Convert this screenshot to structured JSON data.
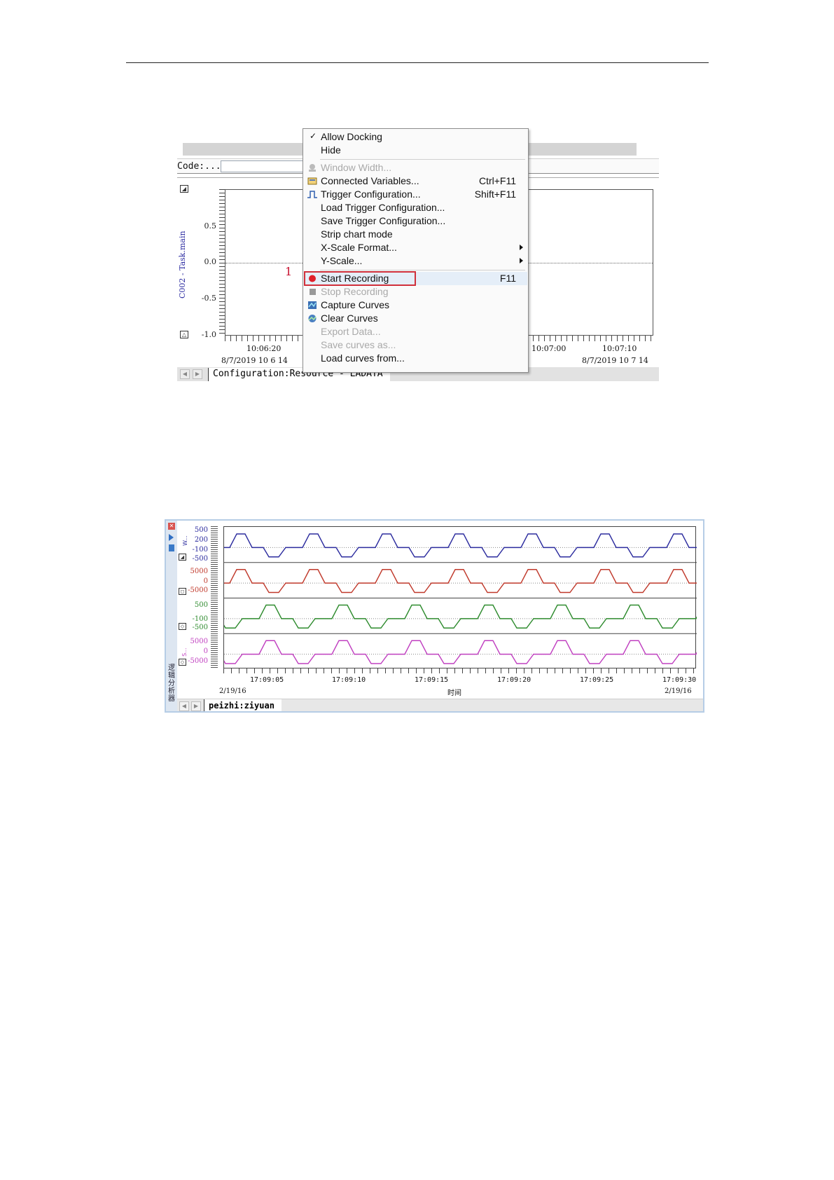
{
  "screenshot1": {
    "code_label": "Code:...",
    "y_axis_label": "C002 - Task.main",
    "y_ticks": [
      "0.5",
      "0.0",
      "-0.5",
      "-1.0"
    ],
    "x_ticks": [
      {
        "time": "10:06:20",
        "date": "8/7/2019 10 6 14"
      },
      {
        "time": "10:07:00",
        "date": ""
      },
      {
        "time": "10:07:10",
        "date": "8/7/2019 10 7 14"
      }
    ],
    "marker_label": "1",
    "tab_label": "Configuration:Resource - LADATA",
    "context_menu": {
      "items": [
        {
          "label": "Allow Docking",
          "shortcut": "",
          "checked": true,
          "enabled": true
        },
        {
          "label": "Hide",
          "shortcut": "",
          "enabled": true
        },
        {
          "label": "Window Width...",
          "shortcut": "",
          "enabled": false,
          "icon": "window-width-icon"
        },
        {
          "label": "Connected Variables...",
          "shortcut": "Ctrl+F11",
          "enabled": true,
          "icon": "connected-variables-icon"
        },
        {
          "label": "Trigger Configuration...",
          "shortcut": "Shift+F11",
          "enabled": true,
          "icon": "trigger-icon"
        },
        {
          "label": "Load Trigger Configuration...",
          "shortcut": "",
          "enabled": true
        },
        {
          "label": "Save Trigger Configuration...",
          "shortcut": "",
          "enabled": true
        },
        {
          "label": "Strip chart mode",
          "shortcut": "",
          "enabled": true
        },
        {
          "label": "X-Scale Format...",
          "shortcut": "",
          "enabled": true,
          "submenu": true
        },
        {
          "label": "Y-Scale...",
          "shortcut": "",
          "enabled": true,
          "submenu": true
        },
        {
          "label": "Start Recording",
          "shortcut": "F11",
          "enabled": true,
          "icon": "record-icon",
          "highlighted": true
        },
        {
          "label": "Stop Recording",
          "shortcut": "",
          "enabled": false,
          "icon": "stop-icon"
        },
        {
          "label": "Capture Curves",
          "shortcut": "",
          "enabled": true,
          "icon": "capture-curves-icon"
        },
        {
          "label": "Clear Curves",
          "shortcut": "",
          "enabled": true,
          "icon": "clear-curves-icon"
        },
        {
          "label": "Export Data...",
          "shortcut": "",
          "enabled": false
        },
        {
          "label": "Save curves as...",
          "shortcut": "",
          "enabled": false
        },
        {
          "label": "Load curves from...",
          "shortcut": "",
          "enabled": true
        }
      ]
    },
    "colors": {
      "highlight_box": "#d0303b",
      "axis_label": "#2a2aa0"
    }
  },
  "screenshot2": {
    "side_title": "逻辑分析器",
    "tab_label": "peizhi:ziyuan",
    "x_label": "时间",
    "dates": [
      "2/19/16",
      "2/19/16"
    ],
    "chart_data": {
      "type": "line",
      "x_ticks": [
        "17:09:05",
        "17:09:10",
        "17:09:15",
        "17:09:20",
        "17:09:25",
        "17:09:30"
      ],
      "series": [
        {
          "color": "#2b2b9e",
          "y_ticks": [
            "500",
            "200",
            "-100",
            "-500"
          ],
          "lane_label": "W..."
        },
        {
          "color": "#c0392b",
          "y_ticks": [
            "5000",
            "0",
            "-5000"
          ],
          "lane_label": ""
        },
        {
          "color": "#2e8b2e",
          "y_ticks": [
            "500",
            "-100",
            "-500"
          ],
          "lane_label": ""
        },
        {
          "color": "#c040c0",
          "y_ticks": [
            "5000",
            "0",
            "-5000"
          ],
          "lane_label": "S..."
        }
      ]
    }
  }
}
